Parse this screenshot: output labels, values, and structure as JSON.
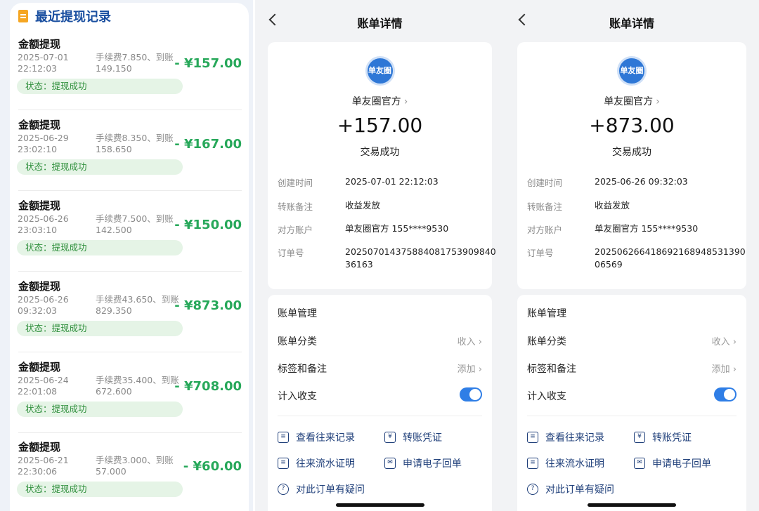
{
  "left": {
    "title": "最近提现记录",
    "records": [
      {
        "title": "金额提现",
        "date": "2025-07-01\n22:12:03",
        "fee": "手续费7.850、到账149.150",
        "amount": "- ¥157.00",
        "status": "状态：提现成功"
      },
      {
        "title": "金额提现",
        "date": "2025-06-29\n23:02:10",
        "fee": "手续费8.350、到账158.650",
        "amount": "- ¥167.00",
        "status": "状态：提现成功"
      },
      {
        "title": "金额提现",
        "date": "2025-06-26\n23:03:10",
        "fee": "手续费7.500、到账142.500",
        "amount": "- ¥150.00",
        "status": "状态：提现成功"
      },
      {
        "title": "金额提现",
        "date": "2025-06-26\n09:32:03",
        "fee": "手续费43.650、到账829.350",
        "amount": "- ¥873.00",
        "status": "状态：提现成功"
      },
      {
        "title": "金额提现",
        "date": "2025-06-24\n22:01:08",
        "fee": "手续费35.400、到账672.600",
        "amount": "- ¥708.00",
        "status": "状态：提现成功"
      },
      {
        "title": "金额提现",
        "date": "2025-06-21\n22:30:06",
        "fee": "手续费3.000、到账57.000",
        "amount": "- ¥60.00",
        "status": "状态：提现成功"
      }
    ]
  },
  "details": [
    {
      "nav_title": "账单详情",
      "logo_text": "单友圈",
      "merchant": "单友圈官方",
      "amount": "+157.00",
      "status": "交易成功",
      "fields": [
        {
          "label": "创建时间",
          "value": "2025-07-01 22:12:03"
        },
        {
          "label": "转账备注",
          "value": "收益发放"
        },
        {
          "label": "对方账户",
          "value": "单友圈官方 155****9530"
        },
        {
          "label": "订单号",
          "value": "20250701437588408175390984036163"
        }
      ],
      "mgmt_title": "账单管理",
      "rows": [
        {
          "label": "账单分类",
          "value": "收入"
        },
        {
          "label": "标签和备注",
          "value": "添加"
        },
        {
          "label": "计入收支",
          "value": ""
        }
      ],
      "toggle_on": true,
      "actions": [
        "查看往来记录",
        "转账凭证",
        "往来流水证明",
        "申请电子回单",
        "对此订单有疑问"
      ]
    },
    {
      "nav_title": "账单详情",
      "logo_text": "单友圈",
      "merchant": "单友圈官方",
      "amount": "+873.00",
      "status": "交易成功",
      "fields": [
        {
          "label": "创建时间",
          "value": "2025-06-26 09:32:03"
        },
        {
          "label": "转账备注",
          "value": "收益发放"
        },
        {
          "label": "对方账户",
          "value": "单友圈官方 155****9530"
        },
        {
          "label": "订单号",
          "value": "20250626641869216894853139006569"
        }
      ],
      "mgmt_title": "账单管理",
      "rows": [
        {
          "label": "账单分类",
          "value": "收入"
        },
        {
          "label": "标签和备注",
          "value": "添加"
        },
        {
          "label": "计入收支",
          "value": ""
        }
      ],
      "toggle_on": true,
      "actions": [
        "查看往来记录",
        "转账凭证",
        "往来流水证明",
        "申请电子回单",
        "对此订单有疑问"
      ]
    }
  ],
  "colors": {
    "accent": "#2f7ee6",
    "success_green": "#27a85a",
    "title_blue": "#1a4fa0"
  }
}
